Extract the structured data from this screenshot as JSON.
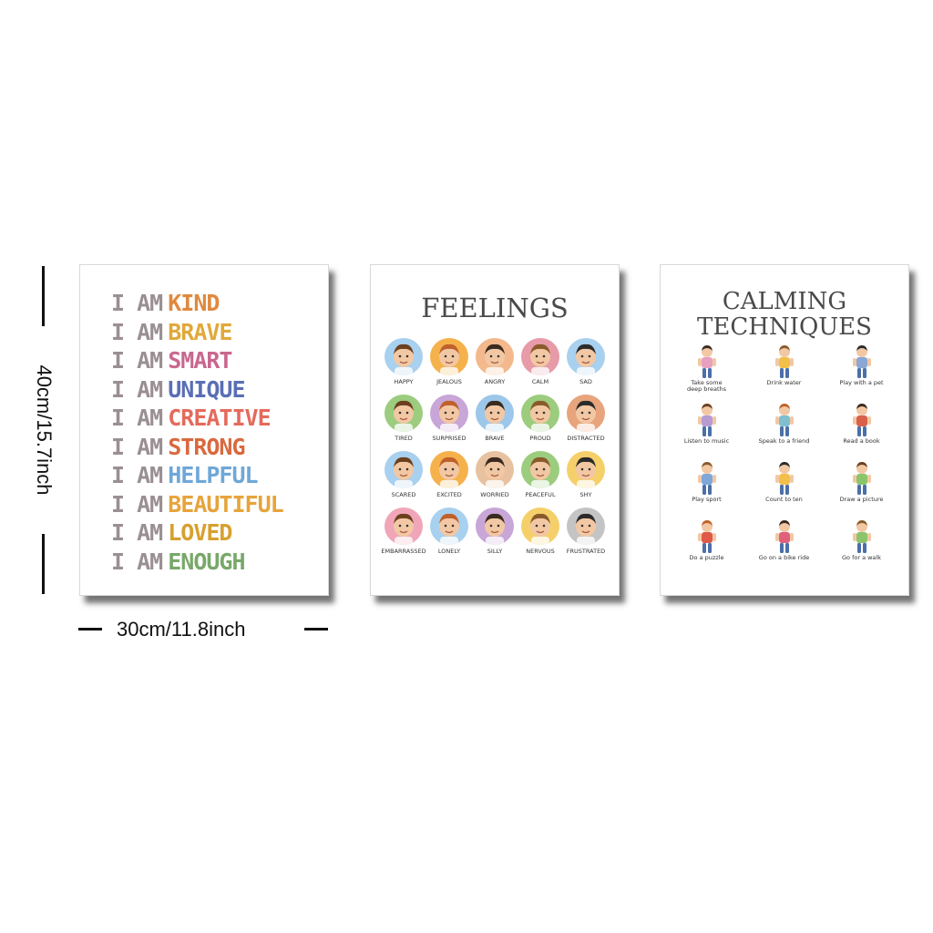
{
  "dimensions": {
    "height_label": "40cm/15.7inch",
    "width_label": "30cm/11.8inch"
  },
  "poster1": {
    "lead": "I AM",
    "lines": [
      {
        "word": "KIND",
        "color": "#e0893e"
      },
      {
        "word": "BRAVE",
        "color": "#e0a93a"
      },
      {
        "word": "SMART",
        "color": "#c9678e"
      },
      {
        "word": "UNIQUE",
        "color": "#5a6fb5"
      },
      {
        "word": "CREATIVE",
        "color": "#e46b5c"
      },
      {
        "word": "STRONG",
        "color": "#d9693f"
      },
      {
        "word": "HELPFUL",
        "color": "#6fa7d8"
      },
      {
        "word": "BEAUTIFUL",
        "color": "#e7a43c"
      },
      {
        "word": "LOVED",
        "color": "#d7a02f"
      },
      {
        "word": "ENOUGH",
        "color": "#79a86a"
      }
    ]
  },
  "poster2": {
    "title": "FEELINGS",
    "items": [
      {
        "label": "HAPPY",
        "color": "#a8d0ef"
      },
      {
        "label": "JEALOUS",
        "color": "#f5b24c"
      },
      {
        "label": "ANGRY",
        "color": "#f3b98c"
      },
      {
        "label": "CALM",
        "color": "#e79aa8"
      },
      {
        "label": "SAD",
        "color": "#a8d0ef"
      },
      {
        "label": "TIRED",
        "color": "#9ccc7e"
      },
      {
        "label": "SURPRISED",
        "color": "#c8a6d7"
      },
      {
        "label": "BRAVE",
        "color": "#9cc7ea"
      },
      {
        "label": "PROUD",
        "color": "#9ccc7e"
      },
      {
        "label": "DISTRACTED",
        "color": "#e8a47c"
      },
      {
        "label": "SCARED",
        "color": "#a8d0ef"
      },
      {
        "label": "EXCITED",
        "color": "#f5b24c"
      },
      {
        "label": "WORRIED",
        "color": "#e8c2a0"
      },
      {
        "label": "PEACEFUL",
        "color": "#9ccc7e"
      },
      {
        "label": "SHY",
        "color": "#f5cf6a"
      },
      {
        "label": "EMBARRASSED",
        "color": "#f0a6b8"
      },
      {
        "label": "LONELY",
        "color": "#a8d0ef"
      },
      {
        "label": "SILLY",
        "color": "#c8a6d7"
      },
      {
        "label": "NERVOUS",
        "color": "#f5cf6a"
      },
      {
        "label": "FRUSTRATED",
        "color": "#c4c4c4"
      }
    ]
  },
  "poster3": {
    "title_line1": "CALMING",
    "title_line2": "TECHNIQUES",
    "items": [
      {
        "label": "Take some\ndeep breaths",
        "shirt": "#e7a0c0"
      },
      {
        "label": "Drink water",
        "shirt": "#f2c04a"
      },
      {
        "label": "Play with a pet",
        "shirt": "#8aa7d6"
      },
      {
        "label": "Listen to music",
        "shirt": "#b79bd1"
      },
      {
        "label": "Speak to a friend",
        "shirt": "#7fbfcf"
      },
      {
        "label": "Read a book",
        "shirt": "#d9614b"
      },
      {
        "label": "Play sport",
        "shirt": "#7fa8d8"
      },
      {
        "label": "Count to ten",
        "shirt": "#f2c04a"
      },
      {
        "label": "Draw a picture",
        "shirt": "#8cc46b"
      },
      {
        "label": "Do a puzzle",
        "shirt": "#e05a4a"
      },
      {
        "label": "Go on a bike ride",
        "shirt": "#e0607a"
      },
      {
        "label": "Go for a walk",
        "shirt": "#8cc46b"
      }
    ]
  }
}
